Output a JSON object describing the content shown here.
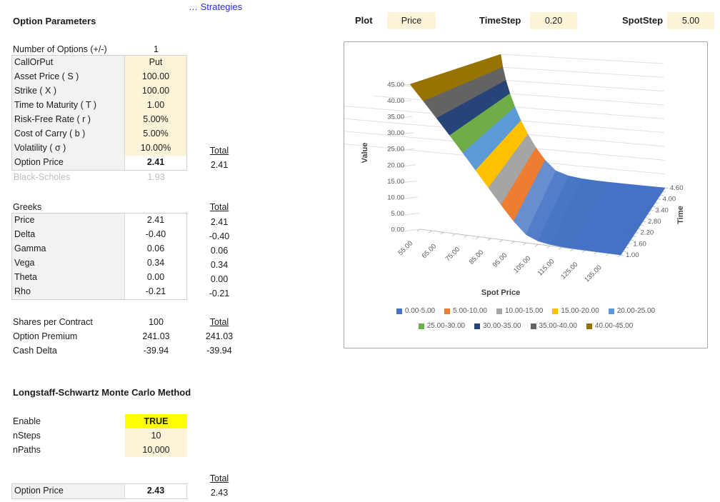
{
  "link": {
    "label": "… Strategies"
  },
  "left": {
    "title": "Option Parameters",
    "num_options": {
      "label": "Number of Options (+/-)",
      "value": "1"
    },
    "params": {
      "rows": [
        {
          "label": "CallOrPut",
          "value": "Put"
        },
        {
          "label": "Asset Price ( S )",
          "value": "100.00"
        },
        {
          "label": "Strike ( X )",
          "value": "100.00"
        },
        {
          "label": "Time to Maturity ( T )",
          "value": "1.00"
        },
        {
          "label": "Risk-Free Rate ( r )",
          "value": "5.00%"
        },
        {
          "label": "Cost of Carry ( b )",
          "value": "5.00%"
        },
        {
          "label": "Volatility ( σ )",
          "value": "10.00%"
        },
        {
          "label": "Option Price",
          "value": "2.41"
        }
      ],
      "total_label": "Total",
      "total_value": "2.41"
    },
    "black_scholes": {
      "label": "Black-Scholes",
      "value": "1.93"
    },
    "greeks": {
      "title": "Greeks",
      "total_label": "Total",
      "rows": [
        {
          "label": "Price",
          "value": "2.41",
          "total": "2.41"
        },
        {
          "label": "Delta",
          "value": "-0.40",
          "total": "-0.40"
        },
        {
          "label": "Gamma",
          "value": "0.06",
          "total": "0.06"
        },
        {
          "label": "Vega",
          "value": "0.34",
          "total": "0.34"
        },
        {
          "label": "Theta",
          "value": "0.00",
          "total": "0.00"
        },
        {
          "label": "Rho",
          "value": "-0.21",
          "total": "-0.21"
        }
      ]
    },
    "contract": {
      "total_label": "Total",
      "rows": [
        {
          "label": "Shares per Contract",
          "value": "100",
          "total": ""
        },
        {
          "label": "Option Premium",
          "value": "241.03",
          "total": "241.03"
        },
        {
          "label": "Cash Delta",
          "value": "-39.94",
          "total": "-39.94"
        }
      ]
    },
    "mc": {
      "title": "Longstaff-Schwartz Monte Carlo Method",
      "rows": [
        {
          "label": "Enable",
          "value": "TRUE"
        },
        {
          "label": "nSteps",
          "value": "10"
        },
        {
          "label": "nPaths",
          "value": "10,000"
        }
      ],
      "total_label": "Total",
      "price_label": "Option Price",
      "price_value": "2.43",
      "total_value": "2.43"
    }
  },
  "controls": {
    "plot_label": "Plot",
    "plot_value": "Price",
    "timestep_label": "TimeStep",
    "timestep_value": "0.20",
    "spotstep_label": "SpotStep",
    "spotstep_value": "5.00"
  },
  "chart_data": {
    "type": "surface",
    "title": "",
    "xlabel": "Spot Price",
    "ylabel": "Value",
    "zlabel": "Time",
    "value_axis": {
      "min": 0,
      "max": 45,
      "step": 5,
      "tick_labels": [
        "0.00",
        "5.00",
        "10.00",
        "15.00",
        "20.00",
        "25.00",
        "30.00",
        "35.00",
        "40.00",
        "45.00"
      ]
    },
    "spot_axis": {
      "categories": [
        55,
        60,
        65,
        70,
        75,
        80,
        85,
        90,
        95,
        100,
        105,
        110,
        115,
        120,
        125,
        130,
        135,
        140
      ],
      "label_values": [
        55,
        65,
        75,
        85,
        95,
        105,
        115,
        125,
        135
      ],
      "tick_labels": [
        "55.00",
        "65.00",
        "75.00",
        "85.00",
        "95.00",
        "105.00",
        "115.00",
        "125.00",
        "135.00"
      ]
    },
    "time_axis": {
      "categories": [
        1.0,
        1.2,
        1.4,
        1.6,
        1.8,
        2.0,
        2.2,
        2.4,
        2.6,
        2.8,
        3.0,
        3.2,
        3.4,
        3.6,
        3.8,
        4.0,
        4.2,
        4.4,
        4.6
      ],
      "label_values": [
        1.0,
        1.6,
        2.2,
        2.8,
        3.4,
        4.0,
        4.6
      ],
      "tick_labels": [
        "1.00",
        "1.60",
        "2.20",
        "2.80",
        "3.40",
        "4.00",
        "4.60"
      ]
    },
    "surface": {
      "description": "American put value vs spot price (strike 100); approximately constant across time",
      "values_by_spot": [
        45.0,
        40.0,
        35.0,
        30.01,
        25.03,
        20.06,
        15.16,
        10.39,
        5.97,
        2.41,
        0.97,
        0.39,
        0.16,
        0.06,
        0.03,
        0.01,
        0.0,
        0.0
      ]
    },
    "legend": {
      "position": "bottom",
      "bands": [
        {
          "label": "0.00-5.00",
          "color": "#4472C4"
        },
        {
          "label": "5.00-10.00",
          "color": "#ED7D31"
        },
        {
          "label": "10.00-15.00",
          "color": "#A5A5A5"
        },
        {
          "label": "15.00-20.00",
          "color": "#FFC000"
        },
        {
          "label": "20.00-25.00",
          "color": "#5B9BD5"
        },
        {
          "label": "25.00-30.00",
          "color": "#70AD47"
        },
        {
          "label": "30.00-35.00",
          "color": "#264478"
        },
        {
          "label": "35.00-40.00",
          "color": "#636363"
        },
        {
          "label": "40.00-45.00",
          "color": "#997300"
        }
      ]
    },
    "grid": true
  }
}
